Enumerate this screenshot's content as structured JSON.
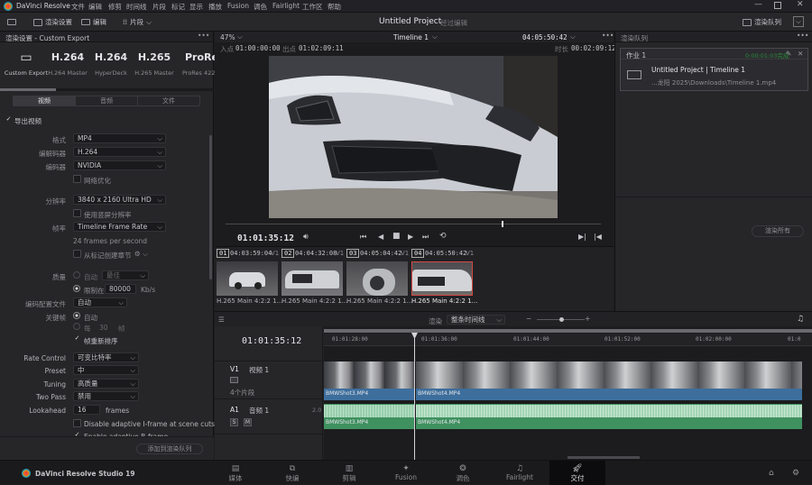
{
  "menubar": {
    "app_name": "DaVinci Resolve",
    "items": [
      "文件",
      "编辑",
      "修剪",
      "时间线",
      "片段",
      "标记",
      "显示",
      "播放",
      "Fusion",
      "调色",
      "Fairlight",
      "工作区",
      "帮助"
    ]
  },
  "toolbar": {
    "render_settings": "渲染设置",
    "clip_label": "片段",
    "thumb_label": "编辑",
    "project_title": "Untitled Project",
    "edited_label": "经过编辑",
    "render_queue": "渲染队列"
  },
  "render_settings": {
    "header": "渲染设置 - Custom Export",
    "presets": [
      {
        "big": "▭",
        "sm": "Custom Export"
      },
      {
        "big": "H.264",
        "sm": "H.264 Master"
      },
      {
        "big": "H.264",
        "sm": "HyperDeck"
      },
      {
        "big": "H.265",
        "sm": "H.265 Master"
      },
      {
        "big": "ProRes",
        "sm": "ProRes 422 H"
      }
    ],
    "tabs": [
      "视频",
      "音频",
      "文件"
    ],
    "export_video": "导出视频",
    "format_label": "格式",
    "format_value": "MP4",
    "codec_label": "编解码器",
    "codec_value": "H.264",
    "encoder_label": "编码器",
    "encoder_value": "NVIDIA",
    "network_opt": "网络优化",
    "resolution_label": "分辨率",
    "resolution_value": "3840 x 2160 Ultra HD",
    "vertical_res": "使用竖屏分辨率",
    "framerate_label": "帧率",
    "framerate_value": "Timeline Frame Rate",
    "framerate_note": "24 frames per second",
    "chapters": "从标记创建章节",
    "quality_label": "质量",
    "quality_auto": "自动",
    "quality_best": "最佳",
    "limit_label": "限制在",
    "limit_value": "80000",
    "limit_unit": "Kb/s",
    "profile_label": "编码配置文件",
    "profile_value": "自动",
    "keyframes_label": "关键帧",
    "keyframes_auto": "自动",
    "keyframes_every": "每",
    "keyframes_n": "30",
    "keyframes_unit": "帧",
    "frame_reorder": "帧重新排序",
    "rate_control_label": "Rate Control",
    "rate_control_value": "可变比特率",
    "preset_label": "Preset",
    "preset_value": "中",
    "tuning_label": "Tuning",
    "tuning_value": "高质量",
    "twopass_label": "Two Pass",
    "twopass_value": "禁用",
    "lookahead_label": "Lookahead",
    "lookahead_value": "16",
    "lookahead_unit": "frames",
    "adaptive_i": "Disable adaptive I-frame at scene cuts",
    "adaptive_b": "Enable adaptive B-frame",
    "add_to_queue": "添加到渲染队列"
  },
  "viewer": {
    "zoom": "47%",
    "timeline_name": "Timeline 1",
    "timecode_top": "04:05:50:42",
    "in_label": "入点",
    "in_value": "01:00:00:00",
    "out_label": "出点",
    "out_value": "01:02:09:11",
    "duration_label": "时长",
    "duration_value": "00:02:09:12",
    "current_tc": "01:01:35:12"
  },
  "clips": [
    {
      "num": "01",
      "tc": "04:03:59:04",
      "track": "V1",
      "name": "H.265 Main 4:2:2 1..."
    },
    {
      "num": "02",
      "tc": "04:04:32:08",
      "track": "V1",
      "name": "H.265 Main 4:2:2 1..."
    },
    {
      "num": "03",
      "tc": "04:05:04:42",
      "track": "V1",
      "name": "H.265 Main 4:2:2 1..."
    },
    {
      "num": "04",
      "tc": "04:05:50:42",
      "track": "V1",
      "name": "H.265 Main 4:2:2 1..."
    }
  ],
  "render_queue": {
    "header": "渲染队列",
    "job_title": "作业 1",
    "job_status": "0:00:01:03完成",
    "job_name": "Untitled Project | Timeline 1",
    "job_path": "...龙阳 2025\\Downloads\\Timeline 1.mp4",
    "render_all": "渲染所有"
  },
  "timeline": {
    "render_label": "渲染",
    "render_mode": "整条时间线",
    "timecode": "01:01:35:12",
    "ruler": [
      "01:01:28:00",
      "01:01:36:00",
      "01:01:44:00",
      "01:01:52:00",
      "01:02:00:00",
      "01:0"
    ],
    "v1_label": "V1",
    "v1_name": "视频 1",
    "v1_count": "4个片段",
    "a1_label": "A1",
    "a1_name": "音频 1",
    "a1_level": "2.0",
    "clip_a": "BMWShot3.MP4",
    "clip_b": "BMWShot4.MP4"
  },
  "pagebar": {
    "brand": "DaVinci Resolve Studio 19",
    "pages": [
      "媒体",
      "快编",
      "剪辑",
      "Fusion",
      "调色",
      "Fairlight",
      "交付"
    ],
    "active_page": "交付"
  },
  "colors": {
    "accent_red": "#d44a44",
    "video_track": "#3d6e9c",
    "audio_track": "#3f9160",
    "active_page_bg": "#101012"
  }
}
